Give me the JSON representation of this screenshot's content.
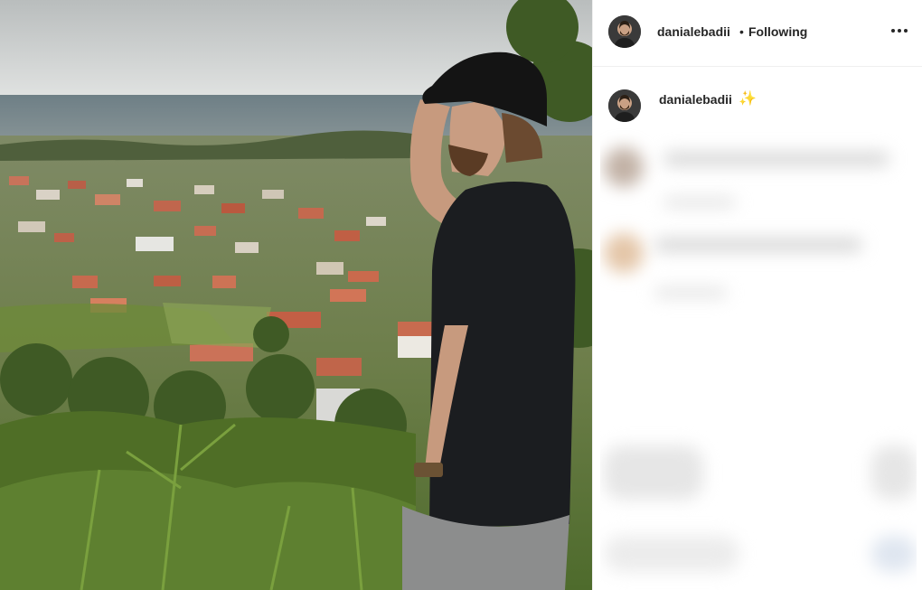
{
  "post": {
    "author": {
      "username": "danialebadii",
      "avatar_icon": "avatar-icon"
    },
    "header": {
      "separator": "•",
      "follow_status": "Following",
      "more_icon": "more-options-icon"
    },
    "caption": {
      "username": "danialebadii",
      "emoji": "✨"
    }
  },
  "colors": {
    "text": "#262626",
    "divider": "#efefef",
    "background": "#ffffff"
  }
}
